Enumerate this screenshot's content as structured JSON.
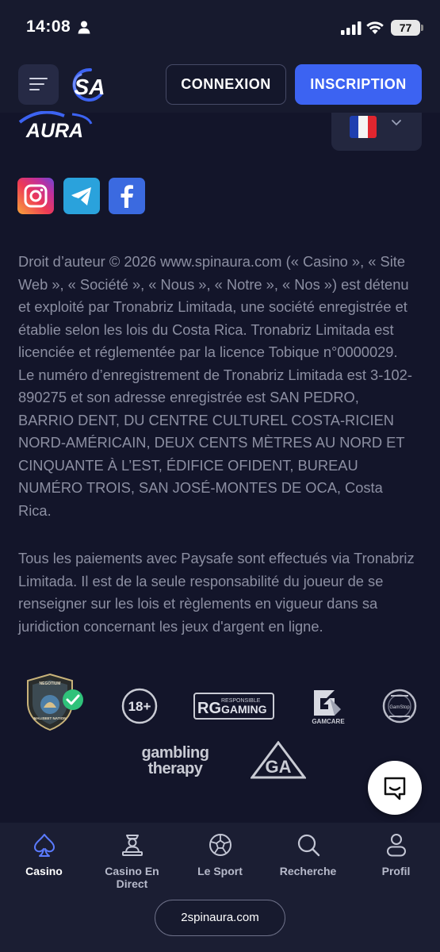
{
  "status_bar": {
    "time": "14:08",
    "battery": "77"
  },
  "header": {
    "logo_text": "SA",
    "login_label": "CONNEXION",
    "signup_label": "INSCRIPTION"
  },
  "footer": {
    "logo_text": "AURA",
    "language_flag": "flag-france-icon",
    "social_icons": [
      "instagram-icon",
      "telegram-icon",
      "facebook-icon"
    ],
    "legal_paragraph_1": "Droit d’auteur © 2026 www.spinaura.com (« Casino », « Site Web », « Société », « Nous », « Notre », « Nos ») est détenu et exploité par Tronabriz Limitada, une société enregistrée et établie selon les lois du Costa Rica. Tronabriz Limitada est licenciée et réglementée par la licence Tobique n°0000029. Le numéro d’enregistrement de Tronabriz Limitada est 3-102-890275 et son adresse enregistrée est SAN PEDRO, BARRIO DENT, DU CENTRE CULTUREL COSTA-RICIEN NORD-AMÉRICAIN, DEUX CENTS MÈTRES AU NORD ET CINQUANTE À L’EST, ÉDIFICE OFIDENT, BUREAU NUMÉRO TROIS, SAN JOSÉ-MONTES DE OCA, Costa Rica.",
    "legal_paragraph_2": "Tous les paiements avec Paysafe sont effectués via Tronabriz Limitada. Il est de la seule responsabilité du joueur de se renseigner sur les lois et règlements en vigueur dans sa juridiction concernant les jeux d'argent en ligne.",
    "badges": {
      "tobique_top": "NEGOTIUM",
      "tobique_bottom": "MALISEET NATION",
      "age": "18+",
      "rg_mark": "RG",
      "rg_small": "RESPONSIBLE",
      "rg_big": "GAMING",
      "gamcare": "GAMCARE",
      "gamstop": "GamStop",
      "gambling_therapy_1": "gambling",
      "gambling_therapy_2": "therapy",
      "ga": "GA"
    }
  },
  "bottom_nav": {
    "items": [
      {
        "label": "Casino",
        "icon": "spade-icon",
        "active": true
      },
      {
        "label": "Casino En Direct",
        "icon": "dealer-icon",
        "active": false
      },
      {
        "label": "Le Sport",
        "icon": "soccer-ball-icon",
        "active": false
      },
      {
        "label": "Recherche",
        "icon": "search-icon",
        "active": false
      },
      {
        "label": "Profil",
        "icon": "profile-icon",
        "active": false
      }
    ],
    "url": "2spinaura.com"
  },
  "colors": {
    "background": "#13152a",
    "accent": "#3c63f2",
    "legal_text": "#8c8fa2"
  }
}
